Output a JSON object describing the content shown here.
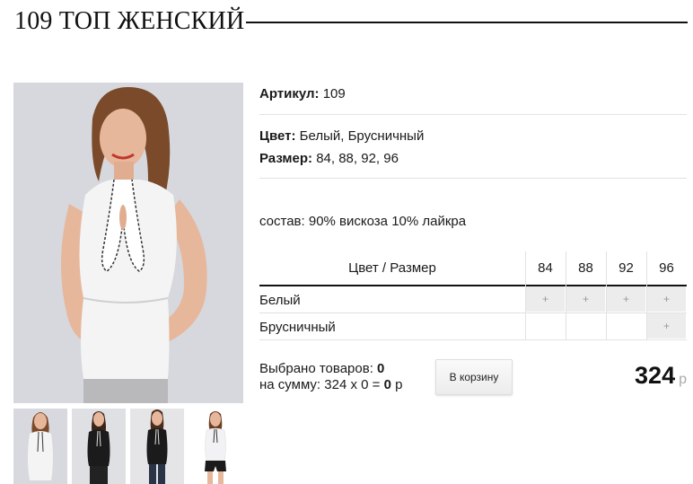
{
  "product": {
    "title": "109 ТОП ЖЕНСКИЙ"
  },
  "gallery": {
    "main_alt": "",
    "thumbnails": [
      "white-top",
      "black-top-1",
      "black-top-2",
      "white-top-shorts"
    ]
  },
  "info": {
    "article_label": "Артикул:",
    "article_value": "109",
    "color_label": "Цвет:",
    "color_value": "Белый, Брусничный",
    "size_label": "Размер:",
    "size_value": "84, 88, 92, 96",
    "composition": "состав: 90% вискоза 10% лайкра"
  },
  "table": {
    "header": "Цвет / Размер",
    "sizes": [
      "84",
      "88",
      "92",
      "96"
    ],
    "rows": [
      {
        "color": "Белый",
        "cells": [
          "+",
          "+",
          "+",
          "+"
        ]
      },
      {
        "color": "Брусничный",
        "cells": [
          "",
          "",
          "",
          "+"
        ]
      }
    ]
  },
  "cart": {
    "selected_label": "Выбрано товаров:",
    "selected_count": "0",
    "sum_label": "на сумму: 324 x 0 =",
    "sum_value": "0",
    "sum_currency": "р",
    "button_label": "В корзину",
    "price": "324",
    "price_currency": "р"
  },
  "colors": {
    "accent_text": "#111111",
    "plus_bg": "#ececec",
    "photo_bg": "#d6d8dd"
  }
}
